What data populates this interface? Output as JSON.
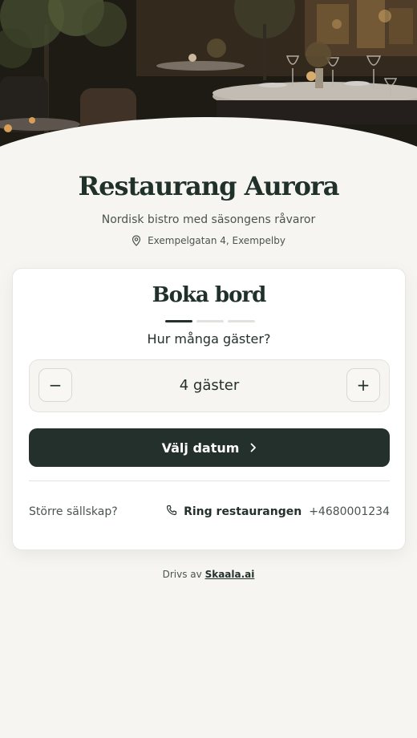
{
  "restaurant": {
    "name": "Restaurang Aurora",
    "tagline": "Nordisk bistro med säsongens råvaror",
    "address": "Exempelgatan 4, Exempelby"
  },
  "booking": {
    "title": "Boka bord",
    "steps_total": 3,
    "step_current": 1,
    "question": "Hur många gäster?",
    "guests_value": "4 gäster",
    "minus_symbol": "−",
    "plus_symbol": "+",
    "continue_label": "Välj datum",
    "large_party_text": "Större sällskap?",
    "call_label": "Ring restaurangen",
    "phone": "+4680001234"
  },
  "footer": {
    "powered_prefix": "Drivs av",
    "powered_link": "Skaala.ai"
  },
  "colors": {
    "background": "#f6f5f1",
    "primary": "#24302c",
    "card": "#ffffff"
  },
  "icons": {
    "address": "map-pin-icon",
    "continue": "chevron-right-icon",
    "call": "phone-icon"
  }
}
